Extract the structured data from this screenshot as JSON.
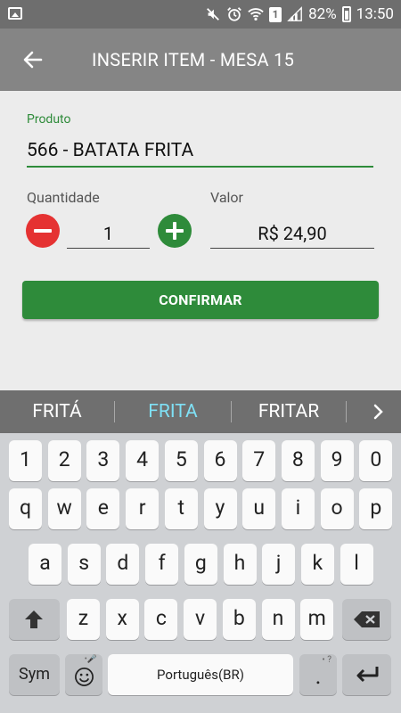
{
  "status_bar": {
    "battery": "82%",
    "time": "13:50",
    "sim_badge": "1"
  },
  "app_bar": {
    "back_icon": "arrow-left-icon",
    "title": "INSERIR ITEM - MESA 15"
  },
  "form": {
    "produto_label": "Produto",
    "produto_value": "566 - BATATA FRITA",
    "quantidade_label": "Quantidade",
    "quantidade_value": "1",
    "valor_label": "Valor",
    "valor_value": "R$ 24,90",
    "confirm_label": "CONFIRMAR",
    "colors": {
      "accent": "#2e8b3a",
      "minus": "#e53232"
    }
  },
  "suggestions": {
    "items": [
      "FRITÁ",
      "FRITA",
      "FRITAR"
    ],
    "selected": "FRITA",
    "more_icon": "chevron-right-icon"
  },
  "keyboard": {
    "row_numbers": [
      "1",
      "2",
      "3",
      "4",
      "5",
      "6",
      "7",
      "8",
      "9",
      "0"
    ],
    "row1": [
      "q",
      "w",
      "e",
      "r",
      "t",
      "y",
      "u",
      "i",
      "o",
      "p"
    ],
    "row2": [
      "a",
      "s",
      "d",
      "f",
      "g",
      "h",
      "j",
      "k",
      "l"
    ],
    "row3": [
      "z",
      "x",
      "c",
      "v",
      "b",
      "n",
      "m"
    ],
    "sym_label": "Sym",
    "space_label": "Português(BR)",
    "period_label": ".",
    "period_hint": "• ?",
    "mic_hint": "• 🎤"
  }
}
